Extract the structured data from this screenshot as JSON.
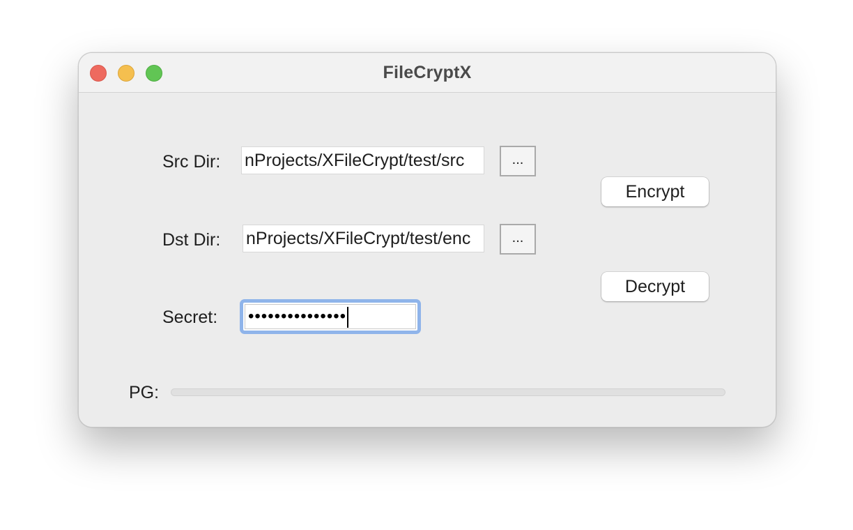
{
  "window": {
    "title": "FileCryptX"
  },
  "src": {
    "label": "Src Dir:",
    "value": "nProjects/XFileCrypt/test/src",
    "browse_label": "..."
  },
  "dst": {
    "label": "Dst Dir:",
    "value": "nProjects/XFileCrypt/test/enc",
    "browse_label": "..."
  },
  "secret": {
    "label": "Secret:",
    "masked_value": "•••••••••••••••"
  },
  "actions": {
    "encrypt_label": "Encrypt",
    "decrypt_label": "Decrypt"
  },
  "progress": {
    "label": "PG:",
    "value": 0
  },
  "colors": {
    "close": "#ee6a5f",
    "minimize": "#f5bf4f",
    "zoom": "#61c554",
    "focus_ring": "#8fb4ea"
  }
}
